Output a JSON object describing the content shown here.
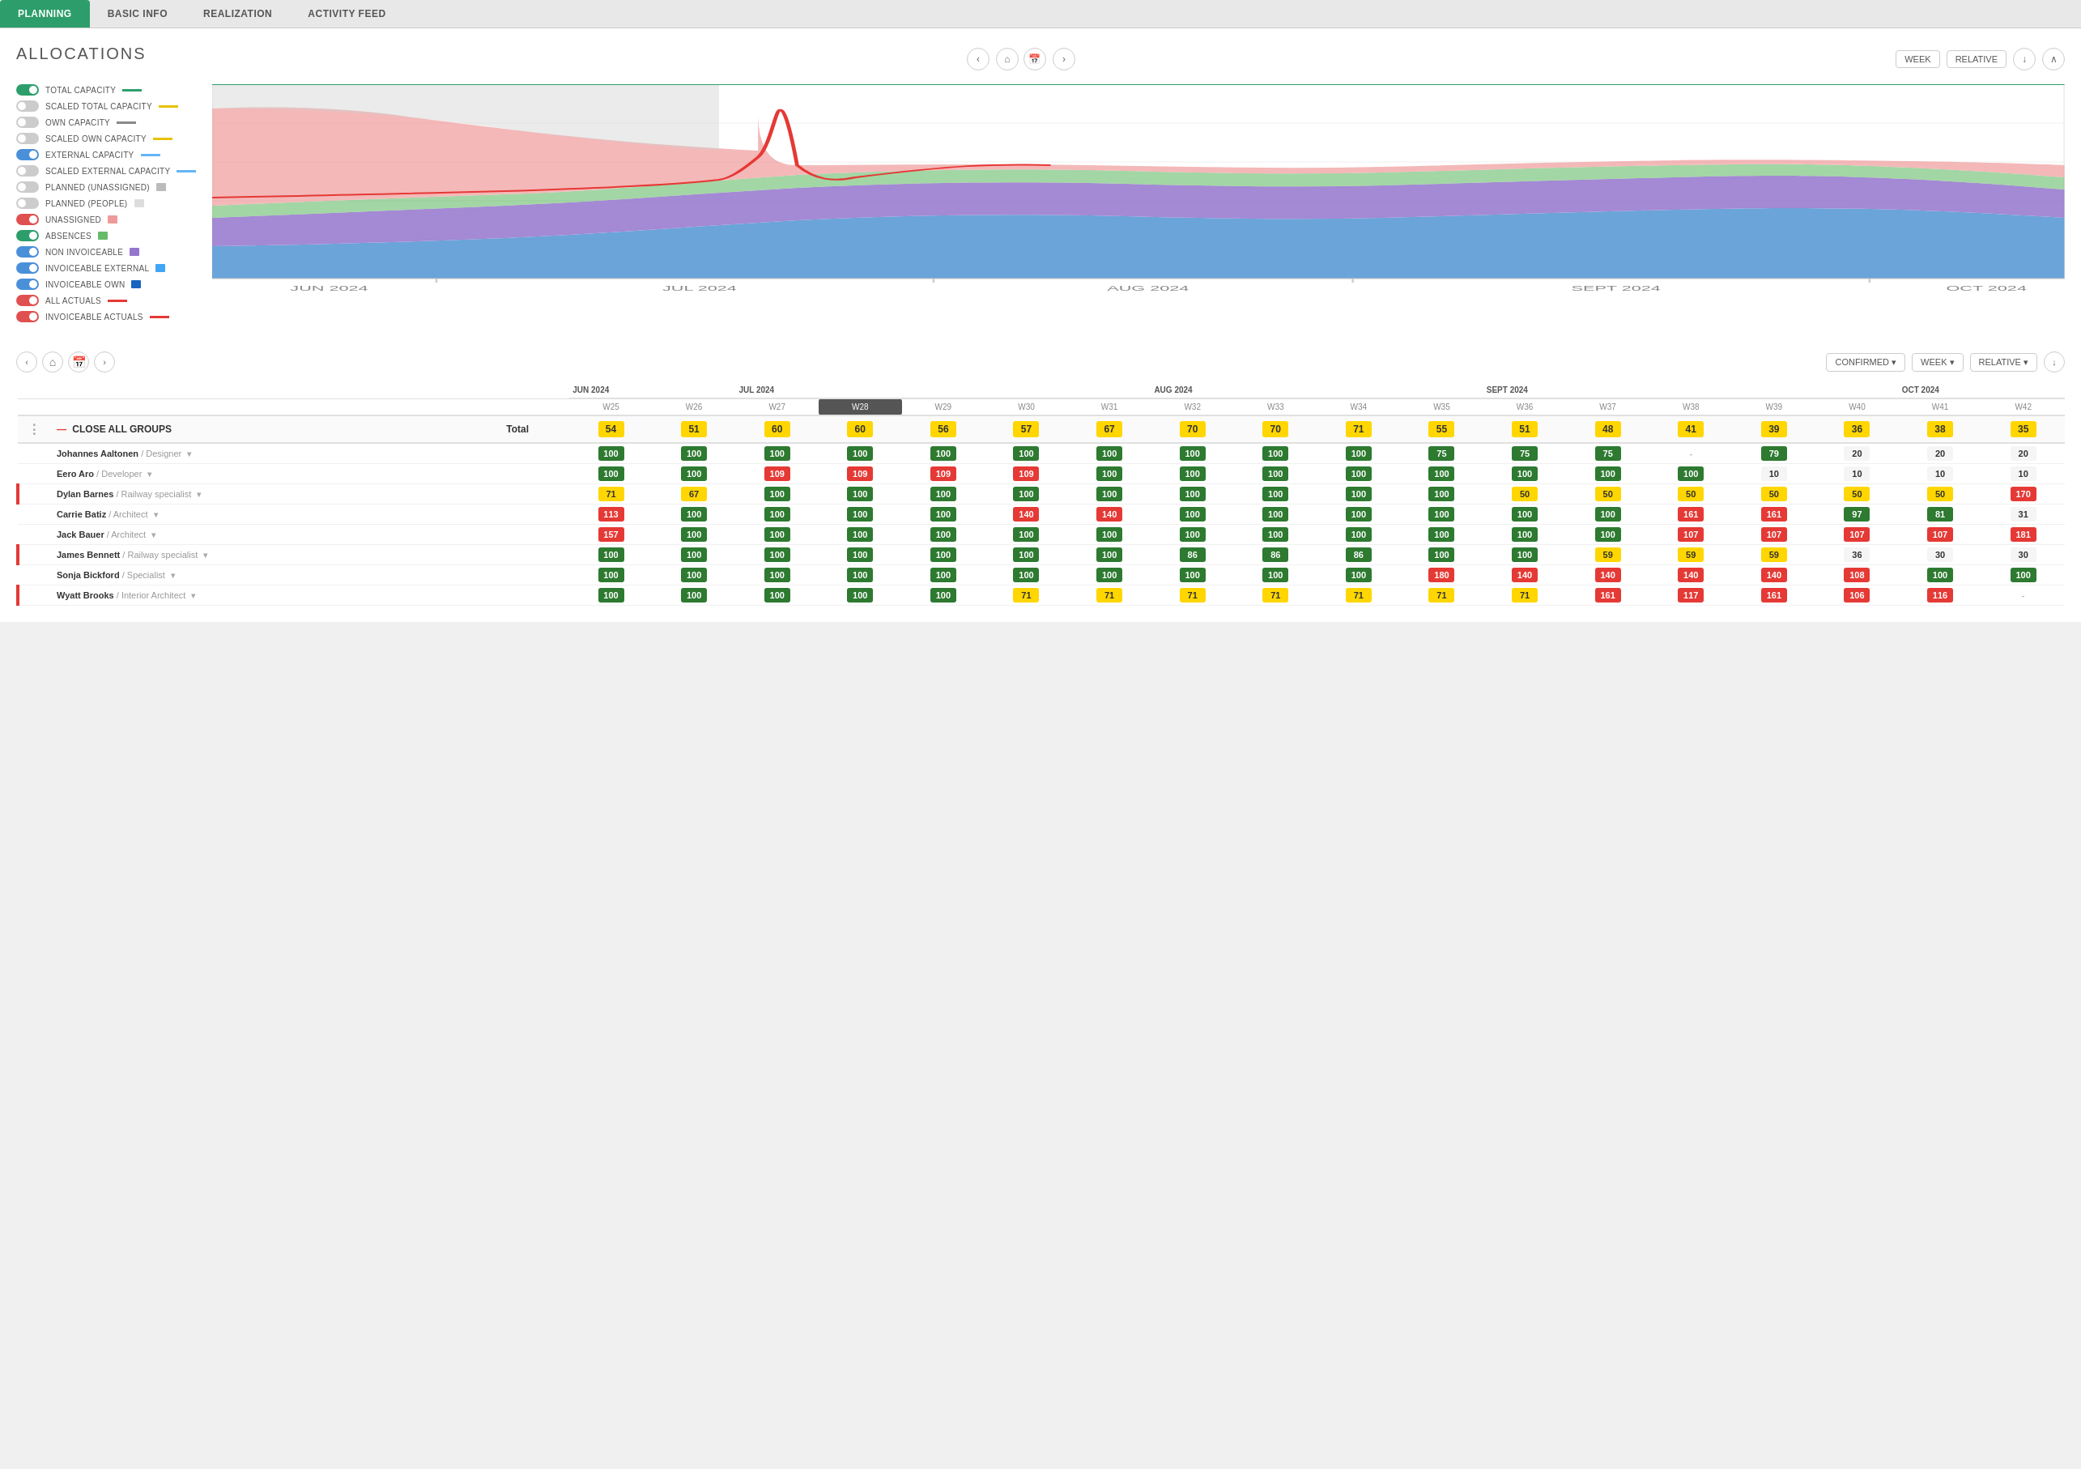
{
  "tabs": [
    {
      "label": "PLANNING",
      "active": true
    },
    {
      "label": "BASIC INFO",
      "active": false
    },
    {
      "label": "REALIZATION",
      "active": false
    },
    {
      "label": "ACTIVITY FEED",
      "active": false
    }
  ],
  "section": {
    "title": "ALLOCATIONS"
  },
  "chart_controls": {
    "week_label": "WEEK",
    "relative_label": "RELATIVE"
  },
  "legend": [
    {
      "id": "total_capacity",
      "label": "TOTAL CAPACITY",
      "toggle": "on-green",
      "line_color": "#2d9e6b"
    },
    {
      "id": "scaled_total",
      "label": "SCALED TOTAL CAPACITY",
      "toggle": "off",
      "line_color": "#e6c300"
    },
    {
      "id": "own_capacity",
      "label": "OWN CAPACITY",
      "toggle": "off",
      "line_color": "#888"
    },
    {
      "id": "scaled_own",
      "label": "SCALED OWN CAPACITY",
      "toggle": "off",
      "line_color": "#e6c300"
    },
    {
      "id": "external_capacity",
      "label": "EXTERNAL CAPACITY",
      "toggle": "on-blue",
      "line_color": "#64b5f6"
    },
    {
      "id": "scaled_external",
      "label": "SCALED EXTERNAL CAPACITY",
      "toggle": "off",
      "line_color": "#64b5f6"
    },
    {
      "id": "planned_unassigned",
      "label": "PLANNED (UNASSIGNED)",
      "toggle": "off",
      "line_color": "#bbb"
    },
    {
      "id": "planned_people",
      "label": "PLANNED (PEOPLE)",
      "toggle": "off",
      "line_color": "#bbb"
    },
    {
      "id": "unassigned",
      "label": "UNASSIGNED",
      "toggle": "on-red",
      "line_color": "#ef9a9a"
    },
    {
      "id": "absences",
      "label": "ABSENCES",
      "toggle": "on-green",
      "line_color": "#66bb6a"
    },
    {
      "id": "non_invoiceable",
      "label": "NON INVOICEABLE",
      "toggle": "on-blue",
      "line_color": "#9575cd"
    },
    {
      "id": "invoiceable_external",
      "label": "INVOICEABLE EXTERNAL",
      "toggle": "on-blue",
      "line_color": "#42a5f5"
    },
    {
      "id": "invoiceable_own",
      "label": "INVOICEABLE OWN",
      "toggle": "on-blue",
      "line_color": "#1565c0"
    },
    {
      "id": "all_actuals",
      "label": "ALL ACTUALS",
      "toggle": "on-red",
      "line_color": "#e53935"
    },
    {
      "id": "invoiceable_actuals",
      "label": "INVOICEABLE ACTUALS",
      "toggle": "on-red",
      "line_color": "#e53935"
    }
  ],
  "grid": {
    "confirmed_label": "CONFIRMED",
    "week_label": "WEEK",
    "relative_label": "RELATIVE",
    "close_all_label": "CLOSE ALL GROUPS",
    "total_label": "Total",
    "months": [
      {
        "label": "JUN 2024",
        "weeks": [
          "W25",
          "W26"
        ]
      },
      {
        "label": "JUL 2024",
        "weeks": [
          "W27",
          "W28",
          "W29",
          "W30",
          "W31"
        ]
      },
      {
        "label": "AUG 2024",
        "weeks": [
          "W32",
          "W33",
          "W34",
          "W35"
        ]
      },
      {
        "label": "SEPT 2024",
        "weeks": [
          "W36",
          "W37",
          "W38",
          "W39",
          "W40"
        ]
      },
      {
        "label": "OCT 2024",
        "weeks": [
          "W41",
          "W42"
        ]
      }
    ],
    "total_row": {
      "values": [
        54,
        51,
        60,
        60,
        56,
        57,
        67,
        70,
        70,
        71,
        55,
        51,
        48,
        41,
        39,
        36,
        38,
        35
      ]
    },
    "people": [
      {
        "name": "Johannes Aaltonen",
        "role": "Designer",
        "has_red_bar": false,
        "values": [
          100,
          100,
          100,
          100,
          100,
          100,
          100,
          100,
          100,
          100,
          75,
          75,
          75,
          null,
          79,
          20,
          20,
          20
        ]
      },
      {
        "name": "Eero Aro",
        "role": "Developer",
        "has_red_bar": false,
        "values": [
          100,
          100,
          109,
          109,
          109,
          109,
          100,
          100,
          100,
          100,
          100,
          100,
          100,
          100,
          10,
          10,
          10,
          10
        ]
      },
      {
        "name": "Dylan Barnes",
        "role": "Railway specialist",
        "has_red_bar": true,
        "values": [
          71,
          67,
          100,
          100,
          100,
          100,
          100,
          100,
          100,
          100,
          100,
          50,
          50,
          50,
          50,
          50,
          50,
          170
        ]
      },
      {
        "name": "Carrie Batiz",
        "role": "Architect",
        "has_red_bar": false,
        "values": [
          113,
          100,
          100,
          100,
          100,
          140,
          140,
          100,
          100,
          100,
          100,
          100,
          100,
          161,
          161,
          97,
          81,
          31
        ]
      },
      {
        "name": "Jack Bauer",
        "role": "Architect",
        "has_red_bar": false,
        "values": [
          157,
          100,
          100,
          100,
          100,
          100,
          100,
          100,
          100,
          100,
          100,
          100,
          100,
          107,
          107,
          107,
          107,
          181
        ]
      },
      {
        "name": "James Bennett",
        "role": "Railway specialist",
        "has_red_bar": true,
        "values": [
          100,
          100,
          100,
          100,
          100,
          100,
          100,
          86,
          86,
          86,
          100,
          100,
          59,
          59,
          59,
          36,
          30,
          30
        ]
      },
      {
        "name": "Sonja Bickford",
        "role": "Specialist",
        "has_red_bar": false,
        "values": [
          100,
          100,
          100,
          100,
          100,
          100,
          100,
          100,
          100,
          100,
          180,
          140,
          140,
          140,
          140,
          108,
          100,
          100
        ]
      },
      {
        "name": "Wyatt Brooks",
        "role": "Interior Architect",
        "has_red_bar": true,
        "values": [
          100,
          100,
          100,
          100,
          100,
          71,
          71,
          71,
          71,
          71,
          71,
          71,
          161,
          117,
          161,
          106,
          116,
          null
        ]
      }
    ]
  }
}
